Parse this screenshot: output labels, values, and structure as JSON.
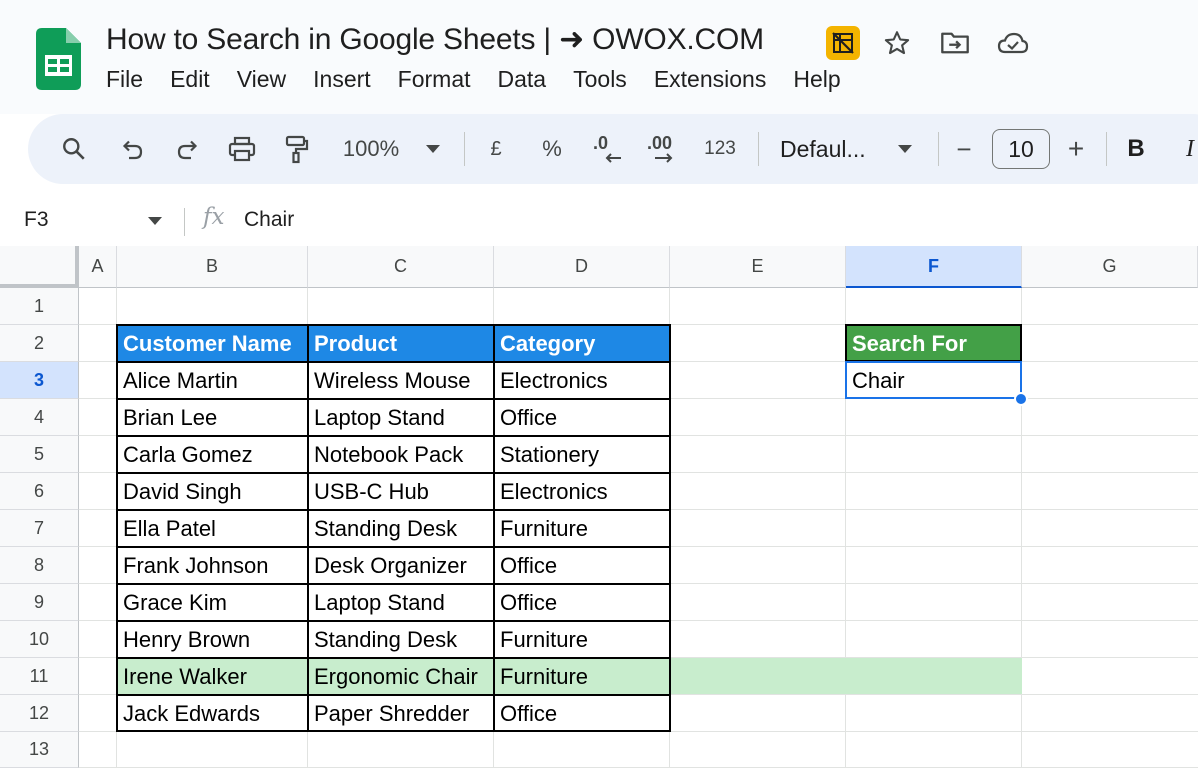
{
  "app": {
    "document_title": "How to Search in Google Sheets | ➜ OWOX.COM"
  },
  "menu": [
    "File",
    "Edit",
    "View",
    "Insert",
    "Format",
    "Data",
    "Tools",
    "Extensions",
    "Help"
  ],
  "toolbar": {
    "zoom": "100%",
    "currency": "£",
    "percent": "%",
    "decrease_decimal": ".0",
    "increase_decimal": ".00",
    "number_format": "123",
    "font": "Defaul...",
    "font_size": "10",
    "bold": "B",
    "italic": "I",
    "minus": "−",
    "plus": "+"
  },
  "formula_bar": {
    "cell_ref": "F3",
    "fx": "fx",
    "value": "Chair"
  },
  "grid": {
    "columns": [
      "A",
      "B",
      "C",
      "D",
      "E",
      "F",
      "G"
    ],
    "rows": [
      "1",
      "2",
      "3",
      "4",
      "5",
      "6",
      "7",
      "8",
      "9",
      "10",
      "11",
      "12",
      "13"
    ],
    "selected_cell": "F3",
    "selected_column": "F",
    "selected_row": "3"
  },
  "table": {
    "headers": [
      "Customer Name",
      "Product",
      "Category"
    ],
    "rows": [
      [
        "Alice Martin",
        "Wireless Mouse",
        "Electronics"
      ],
      [
        "Brian Lee",
        "Laptop Stand",
        "Office"
      ],
      [
        "Carla Gomez",
        "Notebook Pack",
        "Stationery"
      ],
      [
        "David Singh",
        "USB-C Hub",
        "Electronics"
      ],
      [
        "Ella Patel",
        "Standing Desk",
        "Furniture"
      ],
      [
        "Frank Johnson",
        "Desk Organizer",
        "Office"
      ],
      [
        "Grace Kim",
        "Laptop Stand",
        "Office"
      ],
      [
        "Henry Brown",
        "Standing Desk",
        "Furniture"
      ],
      [
        "Irene Walker",
        "Ergonomic Chair",
        "Furniture"
      ],
      [
        "Jack Edwards",
        "Paper Shredder",
        "Office"
      ]
    ],
    "highlighted_row_index": 8
  },
  "search": {
    "label": "Search For",
    "value": "Chair"
  },
  "colors": {
    "table_header_bg": "#1e88e5",
    "search_header_bg": "#43a047",
    "highlight_row_bg": "#c8edcd",
    "selection": "#1a73e8",
    "sheets_green": "#0f9d58"
  }
}
